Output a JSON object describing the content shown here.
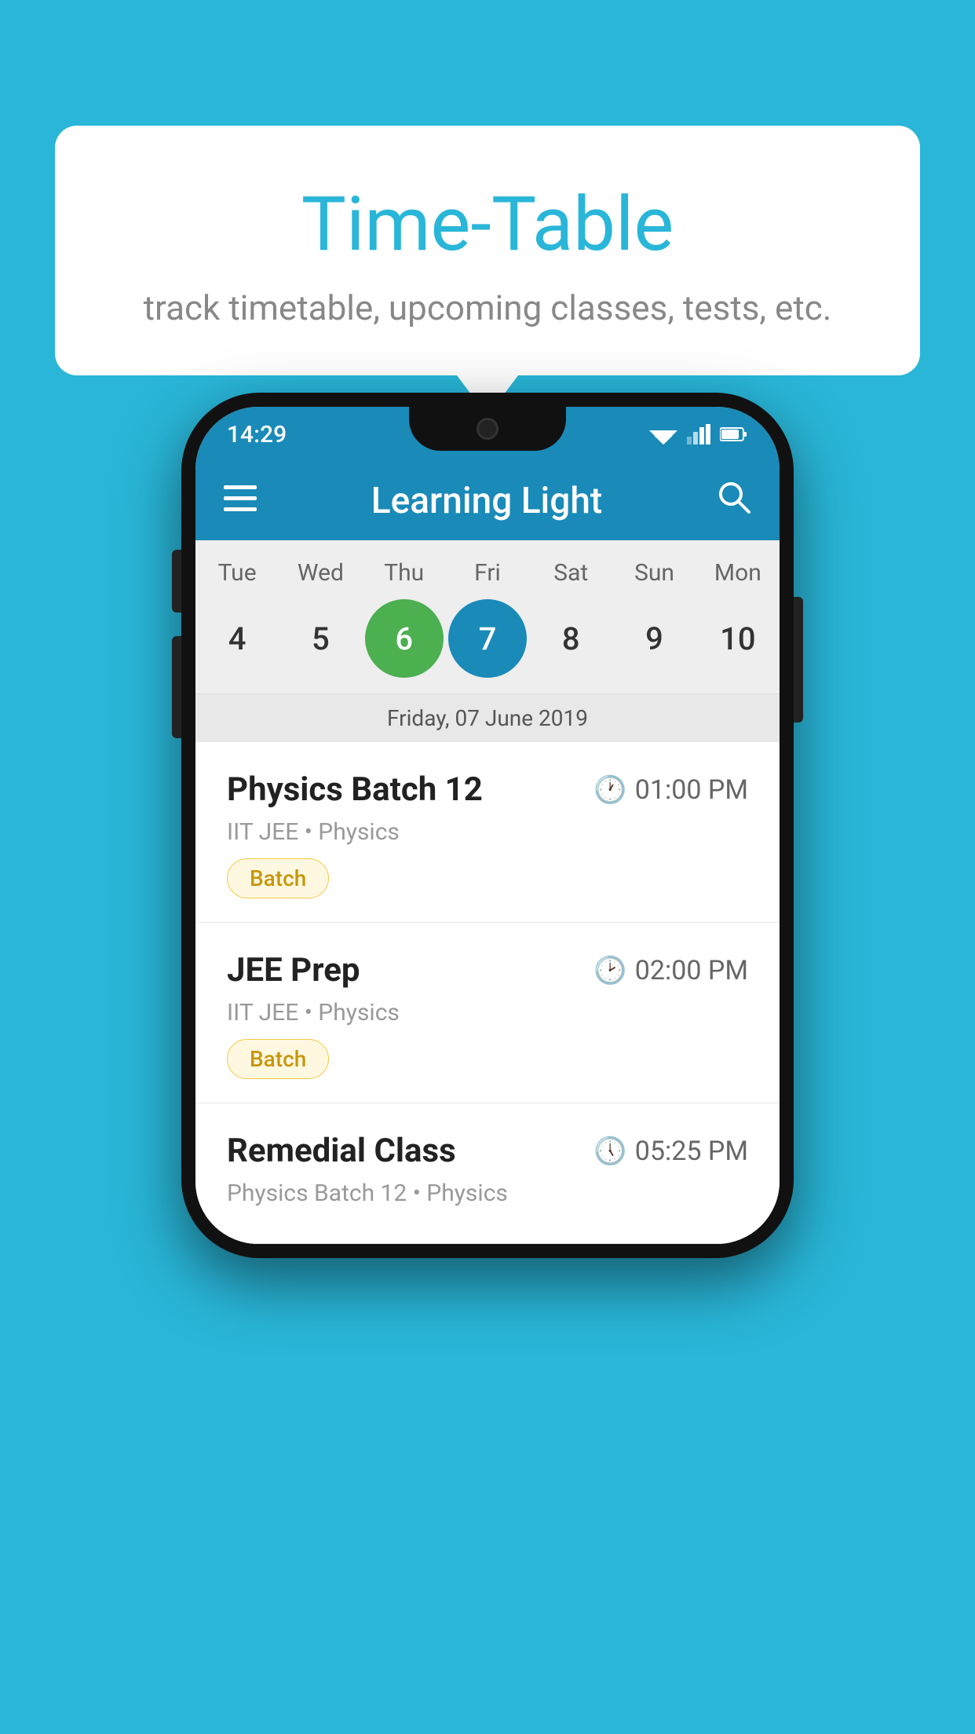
{
  "background": {
    "color": "#29b6d8"
  },
  "tooltip": {
    "title": "Time-Table",
    "subtitle": "track timetable, upcoming classes, tests, etc."
  },
  "phone": {
    "status_bar": {
      "time": "14:29"
    },
    "app_bar": {
      "title": "Learning Light"
    },
    "calendar": {
      "days": [
        {
          "label": "Tue",
          "number": "4"
        },
        {
          "label": "Wed",
          "number": "5"
        },
        {
          "label": "Thu",
          "number": "6",
          "state": "today"
        },
        {
          "label": "Fri",
          "number": "7",
          "state": "selected"
        },
        {
          "label": "Sat",
          "number": "8"
        },
        {
          "label": "Sun",
          "number": "9"
        },
        {
          "label": "Mon",
          "number": "10"
        }
      ],
      "date_label": "Friday, 07 June 2019"
    },
    "schedule": [
      {
        "title": "Physics Batch 12",
        "time": "01:00 PM",
        "sub": "IIT JEE • Physics",
        "tag": "Batch"
      },
      {
        "title": "JEE Prep",
        "time": "02:00 PM",
        "sub": "IIT JEE • Physics",
        "tag": "Batch"
      },
      {
        "title": "Remedial Class",
        "time": "05:25 PM",
        "sub": "Physics Batch 12 • Physics",
        "tag": null
      }
    ]
  }
}
